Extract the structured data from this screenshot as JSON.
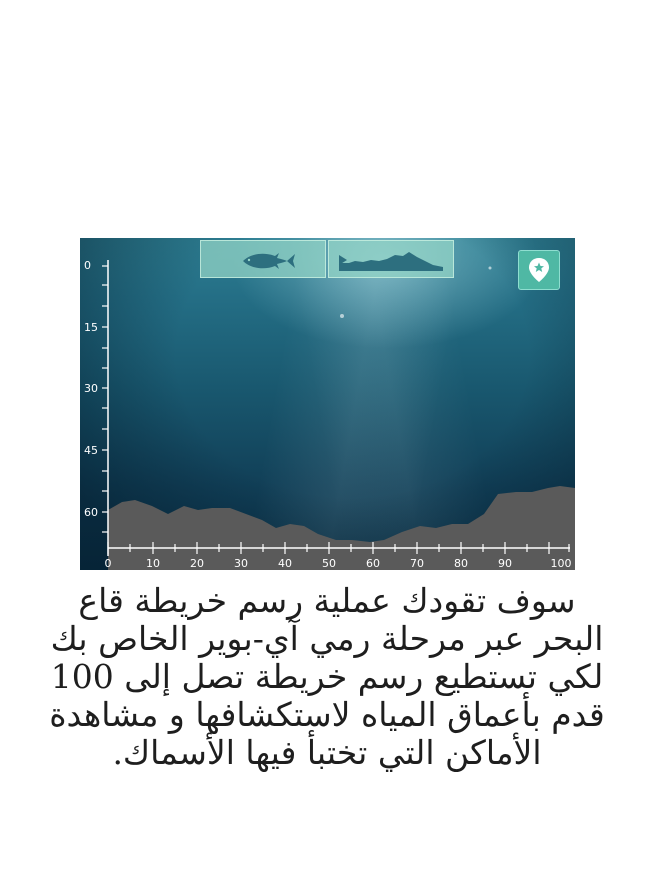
{
  "depth_axis": {
    "labels": [
      "0",
      "15",
      "30",
      "45",
      "60"
    ]
  },
  "distance_axis": {
    "labels": [
      "0",
      "10",
      "20",
      "30",
      "40",
      "50",
      "60",
      "70",
      "80",
      "90",
      "100"
    ]
  },
  "tabs": [
    {
      "icon": "fish-icon"
    },
    {
      "icon": "seabed-profile-icon"
    }
  ],
  "map_button": {
    "icon": "map-pin-star-icon"
  },
  "colors": {
    "water_top": "#2e7f93",
    "water_bottom": "#0b3147",
    "seabed": "#5a5a5a",
    "tab_fill": "#96d7c8",
    "accent": "#4fb8a4"
  },
  "caption": "سوف تقودك عملية رسم خريطة قاع البحر عبر مرحلة رمي آي-بوير الخاص بك لكي تستطيع رسم خريطة تصل إلى 100 قدم بأعماق المياه لاستكشافها و مشاهدة الأماكن التي تختبأ فيها الأسماك."
}
